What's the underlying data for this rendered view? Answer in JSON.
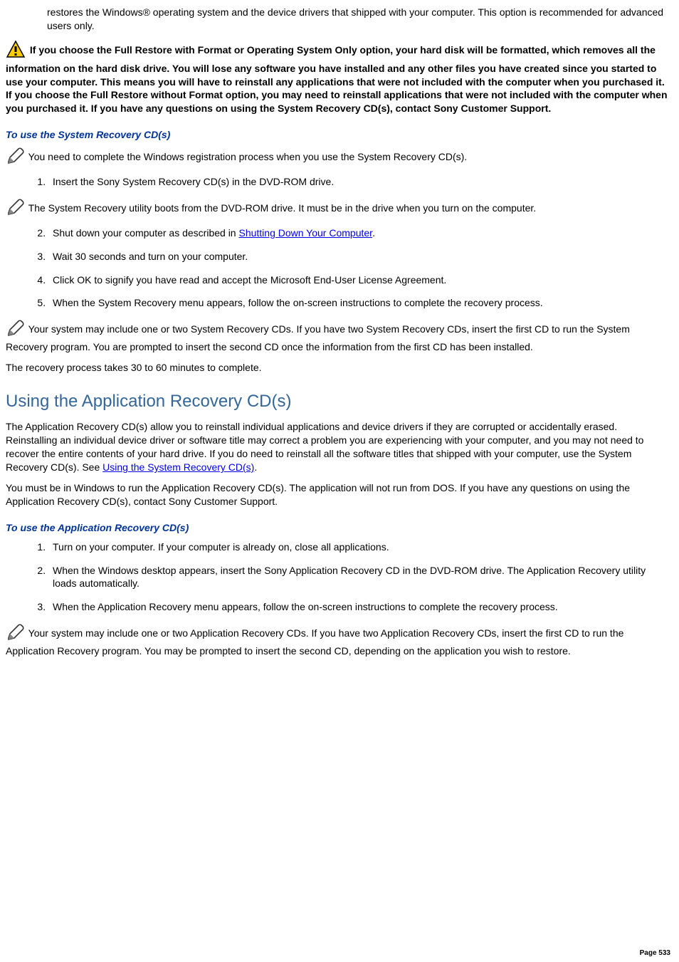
{
  "top_partial": "restores the Windows® operating system and the device drivers that shipped with your computer. This option is recommended for advanced users only.",
  "warning": "If you choose the Full Restore with Format or Operating System Only option, your hard disk will be formatted, which removes all the information on the hard disk drive. You will lose any software you have installed and any other files you have created since you started to use your computer. This means you will have to reinstall any applications that were not included with the computer when you purchased it. If you choose the Full Restore without Format option, you may need to reinstall applications that were not included with the computer when you purchased it. If you have any questions on using the System Recovery CD(s), contact Sony Customer Support.",
  "sys_title": "To use the System Recovery CD(s)",
  "note1": "You need to complete the Windows registration process when you use the System Recovery CD(s).",
  "sys_steps": {
    "s1": "Insert the Sony System Recovery CD(s) in the DVD-ROM drive.",
    "s2a": "Shut down your computer as described in ",
    "s2_link": "Shutting Down Your Computer",
    "s2b": ".",
    "s3": "Wait 30 seconds and turn on your computer.",
    "s4": "Click OK to signify you have read and accept the Microsoft End-User License Agreement.",
    "s5": "When the System Recovery menu appears, follow the on-screen instructions to complete the recovery process."
  },
  "note2": "The System Recovery utility boots from the DVD-ROM drive. It must be in the drive when you turn on the computer.",
  "note3": "Your system may include one or two System Recovery CDs. If you have two System Recovery CDs, insert the first CD to run the System Recovery program. You are prompted to insert the second CD once the information from the first CD has been installed.",
  "note4": "The recovery process takes 30 to 60 minutes to complete.",
  "app_heading": "Using the Application Recovery CD(s)",
  "app_para1a": "The Application Recovery CD(s) allow you to reinstall individual applications and device drivers if they are corrupted or accidentally erased. Reinstalling an individual device driver or software title may correct a problem you are experiencing with your computer, and you may not need to recover the entire contents of your hard drive. If you do need to reinstall all the software titles that shipped with your computer, use the System Recovery CD(s). See ",
  "app_para1_link": "Using the System Recovery CD(s)",
  "app_para1b": ".",
  "app_para2": "You must be in Windows to run the Application Recovery CD(s). The application will not run from DOS. If you have any questions on using the Application Recovery CD(s), contact Sony Customer Support.",
  "app_title": "To use the Application Recovery CD(s)",
  "app_steps": {
    "s1": "Turn on your computer. If your computer is already on, close all applications.",
    "s2": "When the Windows desktop appears, insert the Sony Application Recovery CD in the DVD-ROM drive. The Application Recovery utility loads automatically.",
    "s3": "When the Application Recovery menu appears, follow the on-screen instructions to complete the recovery process."
  },
  "note5": "Your system may include one or two Application Recovery CDs. If you have two Application Recovery CDs, insert the first CD to run the Application Recovery program. You may be prompted to insert the second CD, depending on the application you wish to restore.",
  "page_number": "Page 533"
}
